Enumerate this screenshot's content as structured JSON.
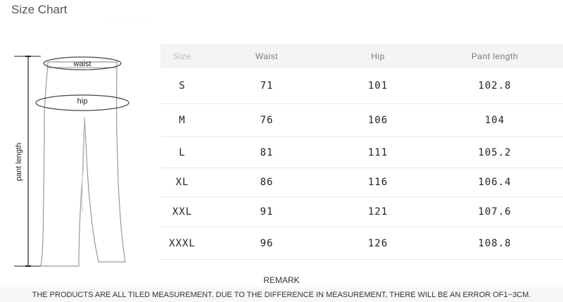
{
  "page": {
    "title": "Size Chart",
    "remark_title": "REMARK",
    "notice": "THE PRODUCTS ARE ALL TILED MEASUREMENT. DUE TO THE DIFFERENCE IN MEASUREMENT, THERE WILL BE AN ERROR OF1~3CM."
  },
  "figure": {
    "waist_label": "waist",
    "hip_label": "hip",
    "length_label": "pant length"
  },
  "table": {
    "headers": [
      "Size",
      "Waist",
      "Hip",
      "Pant length"
    ],
    "rows": [
      {
        "size": "S",
        "waist": "71",
        "hip": "101",
        "length": "102.8"
      },
      {
        "size": "M",
        "waist": "76",
        "hip": "106",
        "length": "104"
      },
      {
        "size": "L",
        "waist": "81",
        "hip": "111",
        "length": "105.2"
      },
      {
        "size": "XL",
        "waist": "86",
        "hip": "116",
        "length": "106.4"
      },
      {
        "size": "XXL",
        "waist": "91",
        "hip": "121",
        "length": "107.6"
      },
      {
        "size": "XXXL",
        "waist": "96",
        "hip": "126",
        "length": "108.8"
      }
    ]
  }
}
